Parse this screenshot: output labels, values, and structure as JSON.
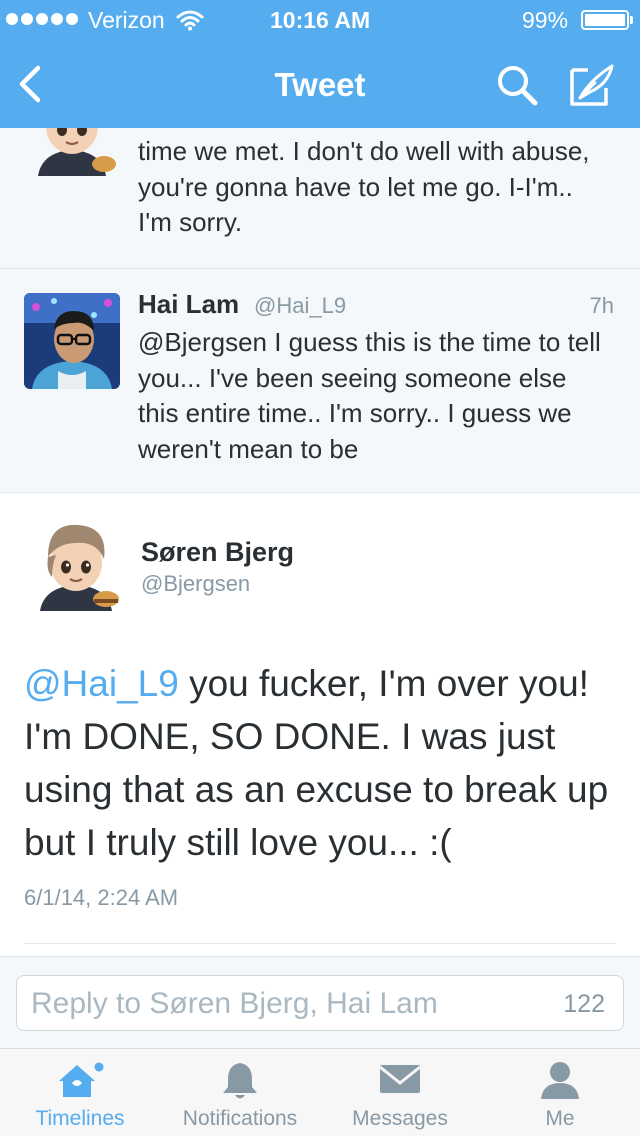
{
  "status_bar": {
    "carrier": "Verizon",
    "time": "10:16 AM",
    "battery": "99%",
    "battery_level": 0.99
  },
  "nav": {
    "title": "Tweet",
    "back_icon": "chevron-left-icon",
    "search_icon": "search-icon",
    "compose_icon": "compose-icon"
  },
  "tweets": [
    {
      "text": "time we met. I don't do well with abuse, you're gonna have to let me go. I-I'm.. I'm sorry."
    },
    {
      "name": "Hai Lam",
      "handle": "@Hai_L9",
      "time": "7h",
      "text": "@Bjergsen I guess this is the time to tell you... I've been seeing someone else this entire time.. I'm sorry.. I guess we weren't mean to be"
    }
  ],
  "focused_tweet": {
    "name": "Søren Bjerg",
    "handle": "@Bjergsen",
    "mention": "@Hai_L9",
    "text": " you fucker, I'm over you! I'm DONE, SO DONE. I was just using that as an excuse to break up but I truly still love you... :(",
    "date": "6/1/14, 2:24 AM"
  },
  "reply": {
    "placeholder": "Reply to Søren Bjerg, Hai Lam",
    "count": "122"
  },
  "tabs": [
    {
      "label": "Timelines",
      "icon": "home-icon",
      "active": true
    },
    {
      "label": "Notifications",
      "icon": "bell-icon",
      "active": false
    },
    {
      "label": "Messages",
      "icon": "envelope-icon",
      "active": false
    },
    {
      "label": "Me",
      "icon": "person-icon",
      "active": false
    }
  ],
  "colors": {
    "brand": "#55acee",
    "text": "#292f33",
    "secondary": "#8899a6",
    "list_bg": "#f5f8fa"
  }
}
